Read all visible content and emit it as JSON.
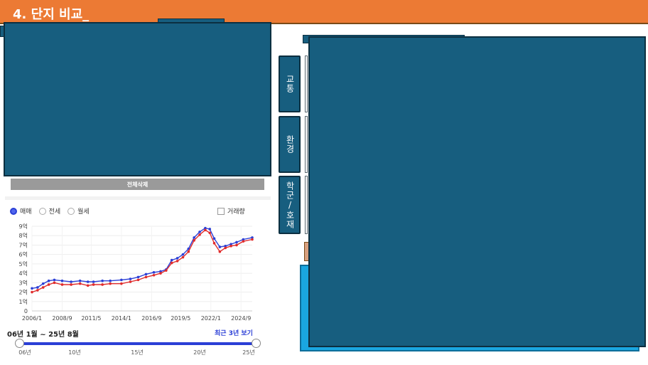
{
  "header": {
    "title": "4. 단지 비교_"
  },
  "side_tabs": [
    {
      "label": "교통"
    },
    {
      "label": "환경"
    },
    {
      "label": "학군/호재"
    }
  ],
  "delete_all_label": "전체삭제",
  "deal_types": {
    "options": [
      "매매",
      "전세",
      "월세"
    ],
    "selected": "매매"
  },
  "volume_label": "거래량",
  "period_text": "06년 1월 ~ 25년 8월",
  "recent_link": "최근 3년 보기",
  "slider": {
    "labels": [
      "06년",
      "10년",
      "15년",
      "20년",
      "25년"
    ],
    "start": "06년",
    "end": "25년"
  },
  "chart_data": {
    "type": "line",
    "title": "",
    "xlabel": "",
    "ylabel": "",
    "y_ticks": [
      "0",
      "1억",
      "2억",
      "3억",
      "4억",
      "5억",
      "6억",
      "7억",
      "8억",
      "9억"
    ],
    "x_ticks": [
      "2006/1",
      "2008/9",
      "2011/5",
      "2014/1",
      "2016/9",
      "2019/5",
      "2022/1",
      "2024/9"
    ],
    "ylim": [
      0,
      9
    ],
    "xlim": [
      2006.0,
      2025.7
    ],
    "grid": true,
    "colors": {
      "upper": "#2b3fd6",
      "lower": "#e02b2b"
    },
    "series": [
      {
        "x": [
          2006.0,
          2006.5,
          2007.0,
          2007.5,
          2008.0,
          2008.7,
          2009.5,
          2010.3,
          2011.0,
          2011.5,
          2012.3,
          2013.0,
          2014.0,
          2014.8,
          2015.5,
          2016.2,
          2016.9,
          2017.5,
          2018.0,
          2018.5,
          2019.0,
          2019.5,
          2020.0,
          2020.5,
          2021.0,
          2021.5,
          2021.9,
          2022.3,
          2022.8,
          2023.3,
          2023.8,
          2024.3,
          2024.9,
          2025.7
        ],
        "values": [
          2.4,
          2.5,
          2.9,
          3.2,
          3.3,
          3.2,
          3.1,
          3.2,
          3.1,
          3.1,
          3.2,
          3.2,
          3.3,
          3.4,
          3.6,
          3.9,
          4.1,
          4.2,
          4.4,
          5.4,
          5.6,
          6.0,
          6.6,
          7.8,
          8.4,
          8.8,
          8.7,
          7.7,
          6.8,
          6.9,
          7.1,
          7.3,
          7.6,
          7.8
        ]
      },
      {
        "x": [
          2006.0,
          2006.5,
          2007.0,
          2007.5,
          2008.0,
          2008.7,
          2009.5,
          2010.3,
          2011.0,
          2011.5,
          2012.3,
          2013.0,
          2014.0,
          2014.8,
          2015.5,
          2016.2,
          2016.9,
          2017.5,
          2018.0,
          2018.5,
          2019.0,
          2019.5,
          2020.0,
          2020.5,
          2021.0,
          2021.5,
          2021.9,
          2022.3,
          2022.8,
          2023.3,
          2023.8,
          2024.3,
          2024.9,
          2025.7
        ],
        "values": [
          2.0,
          2.2,
          2.5,
          2.8,
          3.0,
          2.8,
          2.8,
          2.9,
          2.7,
          2.8,
          2.8,
          2.9,
          2.9,
          3.1,
          3.3,
          3.6,
          3.8,
          4.0,
          4.3,
          5.1,
          5.3,
          5.7,
          6.3,
          7.5,
          8.1,
          8.6,
          8.3,
          7.2,
          6.3,
          6.7,
          6.9,
          7.0,
          7.4,
          7.6
        ]
      }
    ]
  }
}
